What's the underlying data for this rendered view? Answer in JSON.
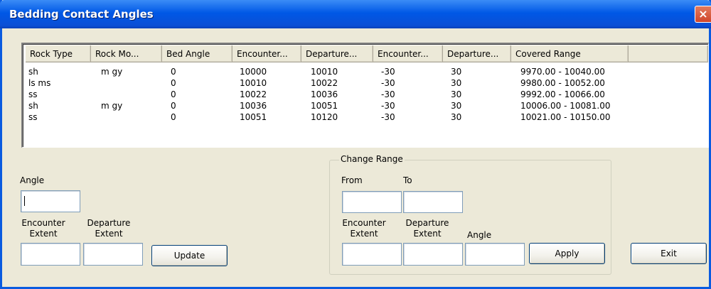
{
  "window": {
    "title": "Bedding Contact Angles",
    "close_glyph": "×"
  },
  "table": {
    "columns": [
      "Rock Type",
      "Rock Mo...",
      "Bed Angle",
      "Encounter...",
      "Departure...",
      "Encounter...",
      "Departure...",
      "Covered Range"
    ],
    "rows": [
      [
        "sh",
        "m gy",
        "0",
        "10000",
        "10010",
        "-30",
        "30",
        "9970.00 - 10040.00"
      ],
      [
        "ls ms",
        "",
        "0",
        "10010",
        "10022",
        "-30",
        "30",
        "9980.00 - 10052.00"
      ],
      [
        "ss",
        "",
        "0",
        "10022",
        "10036",
        "-30",
        "30",
        "9992.00 - 10066.00"
      ],
      [
        "sh",
        "m gy",
        "0",
        "10036",
        "10051",
        "-30",
        "30",
        "10006.00 - 10081.00"
      ],
      [
        "ss",
        "",
        "0",
        "10051",
        "10120",
        "-30",
        "30",
        "10021.00 - 10150.00"
      ]
    ]
  },
  "left_panel": {
    "angle_label": "Angle",
    "angle_value": "",
    "encounter_label_1": "Encounter",
    "encounter_label_2": "Extent",
    "departure_label_1": "Departure",
    "departure_label_2": "Extent",
    "encounter_value": "",
    "departure_value": "",
    "update_label": "Update"
  },
  "change_range": {
    "legend": "Change Range",
    "from_label": "From",
    "to_label": "To",
    "from_value": "",
    "to_value": "",
    "encounter_label_1": "Encounter",
    "encounter_label_2": "Extent",
    "departure_label_1": "Departure",
    "departure_label_2": "Extent",
    "angle_label": "Angle",
    "encounter_value": "",
    "departure_value": "",
    "angle_value": "",
    "apply_label": "Apply"
  },
  "exit_label": "Exit",
  "colors": {
    "titlebar": "#0058E6",
    "close": "#D0452A",
    "dialog_bg": "#ECE9D8"
  }
}
